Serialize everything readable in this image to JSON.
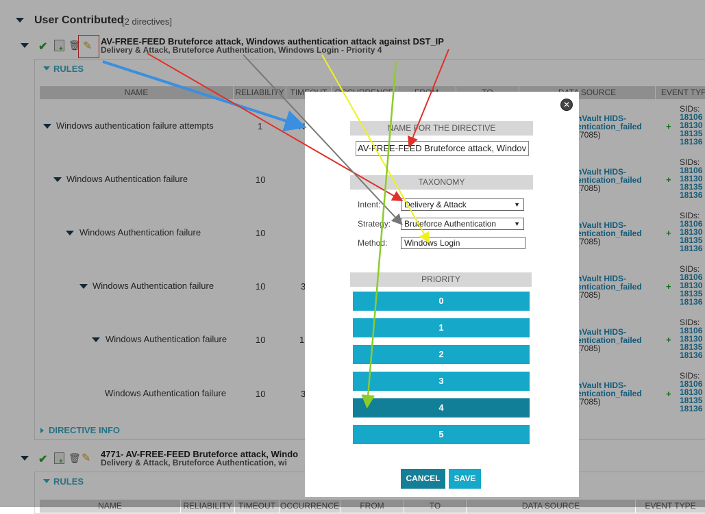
{
  "section": {
    "title": "User Contributed",
    "count": "[2 directives]"
  },
  "directive1": {
    "title": "AV-FREE-FEED Bruteforce attack, Windows authentication attack against DST_IP",
    "taxonomy": "Delivery & Attack, Bruteforce Authentication, Windows Login - Priority 4",
    "rules_label": "RULES",
    "info_label": "DIRECTIVE INFO"
  },
  "table": {
    "headers": [
      "NAME",
      "RELIABILITY",
      "TIMEOUT",
      "OCCURRENCE",
      "FROM",
      "TO",
      "DATA SOURCE",
      "EVENT TYPE"
    ],
    "rows": [
      {
        "name": "Windows authentication failure attempts",
        "reliability": "1",
        "timeout": "N",
        "ds_a": "nVault HIDS-",
        "ds_b": "entication_failed",
        "ds_c": "(7085)"
      },
      {
        "name": "Windows Authentication failure",
        "reliability": "10",
        "timeout": "",
        "ds_a": "nVault HIDS-",
        "ds_b": "entication_failed",
        "ds_c": "(7085)"
      },
      {
        "name": "Windows Authentication failure",
        "reliability": "10",
        "timeout": "",
        "ds_a": "nVault HIDS-",
        "ds_b": "entication_failed",
        "ds_c": "(7085)"
      },
      {
        "name": "Windows Authentication failure",
        "reliability": "10",
        "timeout": "3",
        "ds_a": "nVault HIDS-",
        "ds_b": "entication_failed",
        "ds_c": "(7085)"
      },
      {
        "name": "Windows Authentication failure",
        "reliability": "10",
        "timeout": "1",
        "ds_a": "nVault HIDS-",
        "ds_b": "entication_failed",
        "ds_c": "(7085)"
      },
      {
        "name": "Windows Authentication failure",
        "reliability": "10",
        "timeout": "3",
        "ds_a": "nVault HIDS-",
        "ds_b": "entication_failed",
        "ds_c": "(7085)"
      }
    ],
    "sids_label": "SIDs:",
    "sids": [
      "18106",
      "18130",
      "18135",
      "18136"
    ]
  },
  "directive2": {
    "title": "4771- AV-FREE-FEED Bruteforce attack, Windo",
    "taxonomy": "Delivery & Attack, Bruteforce Authentication, wi",
    "rules_label": "RULES",
    "headers": [
      "NAME",
      "RELIABILITY",
      "TIMEOUT",
      "OCCURRENCE",
      "FROM",
      "TO",
      "DATA SOURCE",
      "EVENT TYPE"
    ]
  },
  "modal": {
    "name_header": "NAME FOR THE DIRECTIVE",
    "name_value": "AV-FREE-FEED Bruteforce attack, Windov",
    "taxonomy_header": "TAXONOMY",
    "intent_label": "Intent:",
    "intent_value": "Delivery & Attack",
    "strategy_label": "Strategy:",
    "strategy_value": "Bruteforce Authentication",
    "method_label": "Method:",
    "method_value": "Windows Login",
    "priority_header": "PRIORITY",
    "priorities": [
      "0",
      "1",
      "2",
      "3",
      "4",
      "5"
    ],
    "selected_priority": "4",
    "cancel": "CANCEL",
    "save": "SAVE"
  },
  "colors": {
    "accent": "#15a8c9",
    "selected": "#107f97",
    "dark_button": "#167f98",
    "arrow_blue": "#3a8fe0",
    "arrow_red": "#e0302a",
    "arrow_gray": "#777777",
    "arrow_yellow": "#f0f020",
    "arrow_green": "#8ccc2a"
  }
}
